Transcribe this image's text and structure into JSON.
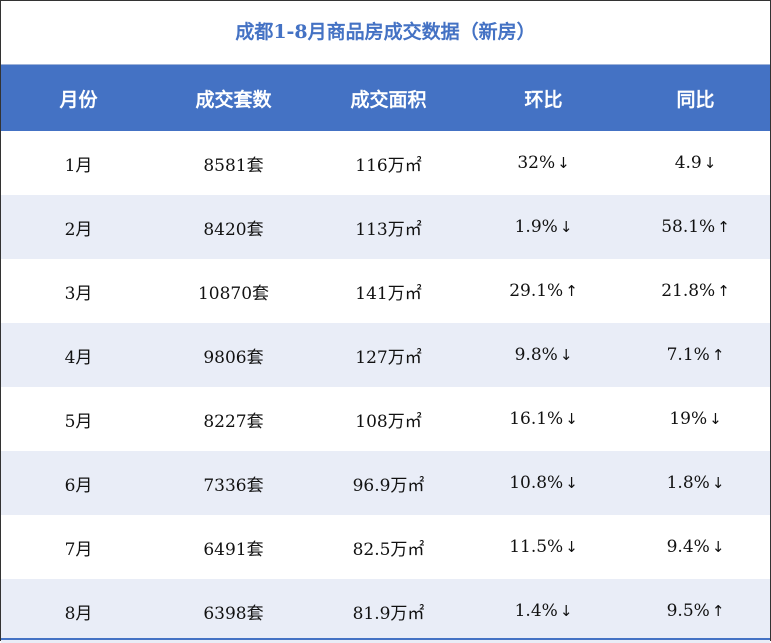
{
  "title": "成都1-8月商品房成交数据（新房）",
  "headers": [
    "月份",
    "成交套数",
    "成交面积",
    "环比",
    "同比"
  ],
  "rows": [
    {
      "month": "1月",
      "units": "8581套",
      "area": "116万㎡",
      "mom": "32%",
      "mom_dir": "↓",
      "yoy": "4.9",
      "yoy_dir": "↓"
    },
    {
      "month": "2月",
      "units": "8420套",
      "area": "113万㎡",
      "mom": "1.9%",
      "mom_dir": "↓",
      "yoy": "58.1%",
      "yoy_dir": "↑"
    },
    {
      "month": "3月",
      "units": "10870套",
      "area": "141万㎡",
      "mom": "29.1%",
      "mom_dir": "↑",
      "yoy": "21.8%",
      "yoy_dir": "↑"
    },
    {
      "month": "4月",
      "units": "9806套",
      "area": "127万㎡",
      "mom": "9.8%",
      "mom_dir": "↓",
      "yoy": "7.1%",
      "yoy_dir": "↑"
    },
    {
      "month": "5月",
      "units": "8227套",
      "area": "108万㎡",
      "mom": "16.1%",
      "mom_dir": "↓",
      "yoy": "19%",
      "yoy_dir": "↓"
    },
    {
      "month": "6月",
      "units": "7336套",
      "area": "96.9万㎡",
      "mom": "10.8%",
      "mom_dir": "↓",
      "yoy": "1.8%",
      "yoy_dir": "↓"
    },
    {
      "month": "7月",
      "units": "6491套",
      "area": "82.5万㎡",
      "mom": "11.5%",
      "mom_dir": "↓",
      "yoy": "9.4%",
      "yoy_dir": "↓"
    },
    {
      "month": "8月",
      "units": "6398套",
      "area": "81.9万㎡",
      "mom": "1.4%",
      "mom_dir": "↓",
      "yoy": "9.5%",
      "yoy_dir": "↑"
    }
  ],
  "colors": {
    "header_bg": "#4472c4",
    "title": "#4472c4",
    "stripe": "#e9edf7"
  }
}
